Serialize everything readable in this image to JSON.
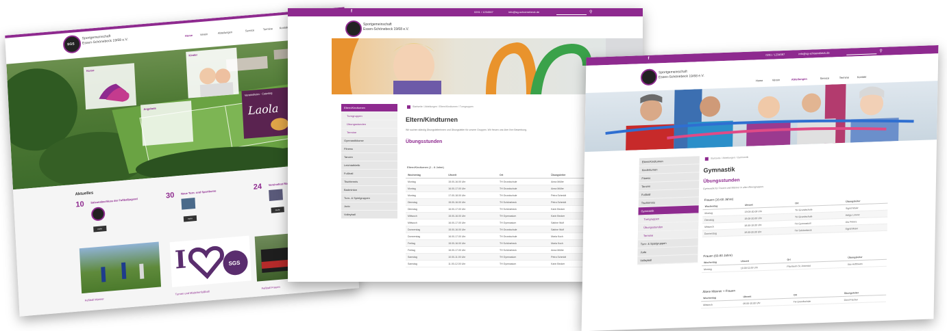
{
  "brand": {
    "line1": "Sportgemeinschaft",
    "line2": "Essen-Schönebeck 19/68 e.V.",
    "logo": "SGS",
    "accent": "#8e2a8f"
  },
  "nav": [
    "Home",
    "Verein",
    "Abteilungen",
    "Service",
    "Termine",
    "Kontakt"
  ],
  "topbar": {
    "phone": "0201 / 1234567",
    "email": "info@sg-schoenebeck.de",
    "search_placeholder": "Suche ..."
  },
  "home": {
    "news_title": "Aktuelles",
    "news": [
      {
        "day": "10",
        "month": "Juni",
        "title": "Saisonabschluss der Fußballjugend",
        "button": "mehr"
      },
      {
        "day": "30",
        "month": "Mai",
        "title": "Neue Turn- und Sportkurse",
        "button": "mehr"
      },
      {
        "day": "24",
        "month": "Mai",
        "title": "Vereinsfest Rückblick",
        "button": "mehr"
      }
    ],
    "teaser_1": "Kurse",
    "teaser_2": "Kinder",
    "teaser_3": "Angebote",
    "laola_kicker": "Vereinsheim · Catering",
    "laola": "Laola",
    "bottom_labels": [
      "Fußball Männer",
      "Turnen und Mädchenfußball",
      "Fußball Frauen"
    ],
    "heart_i": "I"
  },
  "eltern": {
    "breadcrumb": "Startseite / Abteilungen / Eltern/Kindturnen / Turngruppen",
    "title": "Eltern/Kindturnen",
    "intro": "Wir suchen ständig Übungsleiterinnen und Übungsleiter für unsere Gruppen. Wir freuen uns über Ihre Bewerbung.",
    "subtitle": "Übungsstunden",
    "section": "Eltern/Kindturnen (1 - 6 Jahre)",
    "sidebar": [
      "Eltern/Kindturnen",
      "Turngruppen",
      "Übungsstunden",
      "Termine",
      "Gymnastikkurse",
      "Fitness",
      "Tanzen",
      "Leichtathletik",
      "Fußball",
      "Tischtennis",
      "Badminton",
      "Turn- & Spielgruppen",
      "Judo",
      "Volleyball"
    ],
    "columns": [
      "Wochentag",
      "Uhrzeit",
      "Ort",
      "Übungsleiter"
    ],
    "rows": [
      [
        "Montag",
        "15.00-16.00 Uhr",
        "TH Grundschule",
        "Anna Müller"
      ],
      [
        "Montag",
        "16.00-17.00 Uhr",
        "TH Grundschule",
        "Anna Müller"
      ],
      [
        "Montag",
        "17.00-18.00 Uhr",
        "TH Grundschule",
        "Petra Schmidt"
      ],
      [
        "Dienstag",
        "15.00-16.00 Uhr",
        "TH Schönebeck",
        "Petra Schmidt"
      ],
      [
        "Dienstag",
        "16.00-17.00 Uhr",
        "TH Schönebeck",
        "Karin Becker"
      ],
      [
        "Mittwoch",
        "15.00-16.00 Uhr",
        "TH Gymnasium",
        "Karin Becker"
      ],
      [
        "Mittwoch",
        "16.00-17.00 Uhr",
        "TH Gymnasium",
        "Sabine Wolf"
      ],
      [
        "Donnerstag",
        "15.00-16.00 Uhr",
        "TH Grundschule",
        "Sabine Wolf"
      ],
      [
        "Donnerstag",
        "16.00-17.00 Uhr",
        "TH Grundschule",
        "Maria Koch"
      ],
      [
        "Freitag",
        "15.00-16.00 Uhr",
        "TH Schönebeck",
        "Maria Koch"
      ],
      [
        "Freitag",
        "16.00-17.00 Uhr",
        "TH Schönebeck",
        "Anna Müller"
      ],
      [
        "Samstag",
        "10.00-11.00 Uhr",
        "TH Gymnasium",
        "Petra Schmidt"
      ],
      [
        "Samstag",
        "11.00-12.00 Uhr",
        "TH Gymnasium",
        "Karin Becker"
      ]
    ]
  },
  "gym": {
    "breadcrumb": "Startseite / Abteilungen / Gymnastik",
    "title": "Gymnastik",
    "subtitle": "Übungsstunden",
    "intro": "Gymnastik für Frauen und Männer in allen Altersgruppen.",
    "sections": [
      "Frauen (16-60 Jahre)",
      "Frauen (60-80 Jahre)",
      "Ältere Männer + Frauen"
    ],
    "sidebar": [
      "Eltern/Kindturnen",
      "Kinderturnen",
      "Fitness",
      "Tanzen",
      "Fußball",
      "Tischtennis",
      "Gymnastik",
      "Turngruppen",
      "Übungsstunden",
      "Termine",
      "Turn- & Spielgruppen",
      "Judo",
      "Volleyball"
    ],
    "columns": [
      "Wochentag",
      "Uhrzeit",
      "Ort",
      "Übungsleiter"
    ],
    "rows_a": [
      [
        "Montag",
        "19.00-20.00 Uhr",
        "TH Grundschule",
        "Sigrid Maier"
      ],
      [
        "Dienstag",
        "19.00-20.00 Uhr",
        "TH Grundschule",
        "Helga Lorenz"
      ],
      [
        "Mittwoch",
        "18.00-19.00 Uhr",
        "TH Gymnasium",
        "Uta Peters"
      ],
      [
        "Donnerstag",
        "19.00-20.00 Uhr",
        "TH Schönebeck",
        "Sigrid Maier"
      ]
    ],
    "rows_b": [
      [
        "Montag",
        "10.00-11.00 Uhr",
        "Pfarrheim St. Antonius",
        "Ilse Hoffmann"
      ]
    ],
    "rows_c": [
      [
        "Mittwoch",
        "09.00-10.00 Uhr",
        "TH Grundschule",
        "Gerd Fischer"
      ]
    ]
  }
}
